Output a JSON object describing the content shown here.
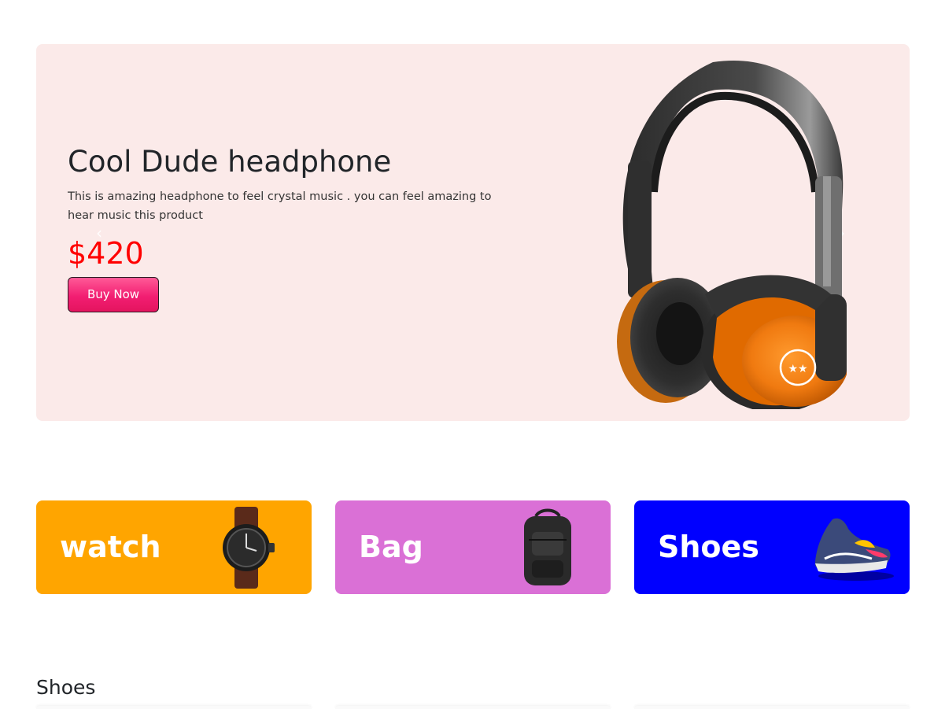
{
  "hero": {
    "title": "Cool Dude headphone",
    "description": "This is amazing headphone to feel crystal music . you can feel amazing to hear music this product",
    "price": "$420",
    "button_label": "Buy Now",
    "background_color": "#fbeae9",
    "price_color": "#ff0000",
    "prev_icon": "chevron-left-icon",
    "next_icon": "chevron-right-icon"
  },
  "categories": [
    {
      "label": "watch",
      "color": "#ffa500",
      "icon": "watch-image"
    },
    {
      "label": "Bag",
      "color": "#da70d6",
      "icon": "backpack-image"
    },
    {
      "label": "Shoes",
      "color": "#0000ff",
      "icon": "sneaker-image"
    }
  ],
  "section": {
    "title": "Shoes"
  }
}
